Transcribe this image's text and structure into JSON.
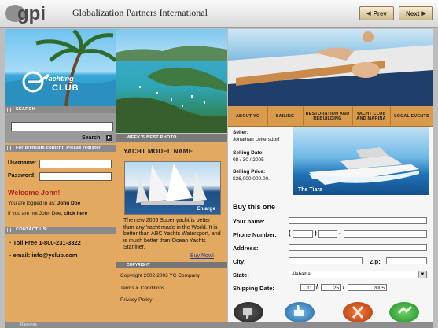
{
  "header": {
    "logo_text": "gpi",
    "company": "Globalization Partners International",
    "prev_label": "Prev",
    "next_label": "Next"
  },
  "left": {
    "club_title": "Yachting",
    "club_sub": "CLUB",
    "search_head": "Search",
    "search_button": "Search",
    "premium_head": "For premium content, Please register.",
    "username_label": "Username:",
    "password_label": "Password:",
    "welcome": "Welcome John!",
    "logged_in_prefix": "You are logged in as:",
    "logged_in_user": "John Doe",
    "not_user_prefix": "If you are not John Doe,",
    "not_user_link": "click here",
    "contact_head": "Contact Us:",
    "tollfree": "Toll Free 1-800-231-3322",
    "email": "email: info@yclub.com",
    "bottom_label": "Rankings"
  },
  "middle": {
    "photo_tag": "Week's Best Photo",
    "yacht_model": "YACHT MODEL NAME",
    "enlarge": "Enlarge",
    "description": "The new 2006 Super yacht is better than any Yacht made in the World. It is better than ABC Yachts Watersport, and is much better than Ocean Yachts Starliner.",
    "buy_now": "Buy Now!",
    "copyright_head": "Copyright",
    "copyright": "Copyright 2002-2003 YC Company",
    "terms": "Terms & Conditions",
    "privacy": "Privacy Policy"
  },
  "right": {
    "nav": [
      {
        "label": "ABOUT YC"
      },
      {
        "label": "SAILING"
      },
      {
        "label": "RESTORATION AND REBUILDING"
      },
      {
        "label": "YACHT CLUB AND MARINA"
      },
      {
        "label": "LOCAL EVENTS"
      }
    ],
    "seller_label": "Seller:",
    "seller_value": "Jonathan Leitersdorf",
    "date_label": "Selling Date:",
    "date_value": "08 / 30 / 2005",
    "price_label": "Selling Price:",
    "price_value": "$36,000,000.00.-",
    "photo_caption": "The Tiara",
    "buy_title": "Buy this one",
    "your_name": "Your name:",
    "phone": "Phone Number:",
    "address": "Address:",
    "city": "City:",
    "zip": "Zip:",
    "state": "State:",
    "state_value": "Alabama",
    "ship_date": "Shipping Date:",
    "ship_month": "11",
    "ship_day": "25",
    "ship_year": "2005",
    "phone_open": "(",
    "phone_close": ")",
    "phone_dash": "-",
    "date_sep": "/"
  },
  "colors": {
    "panel_orange": "#e3a960",
    "nav_orange": "#d99a4b",
    "header_gray": "#8a8a8a",
    "accent_red": "#b0241a"
  }
}
